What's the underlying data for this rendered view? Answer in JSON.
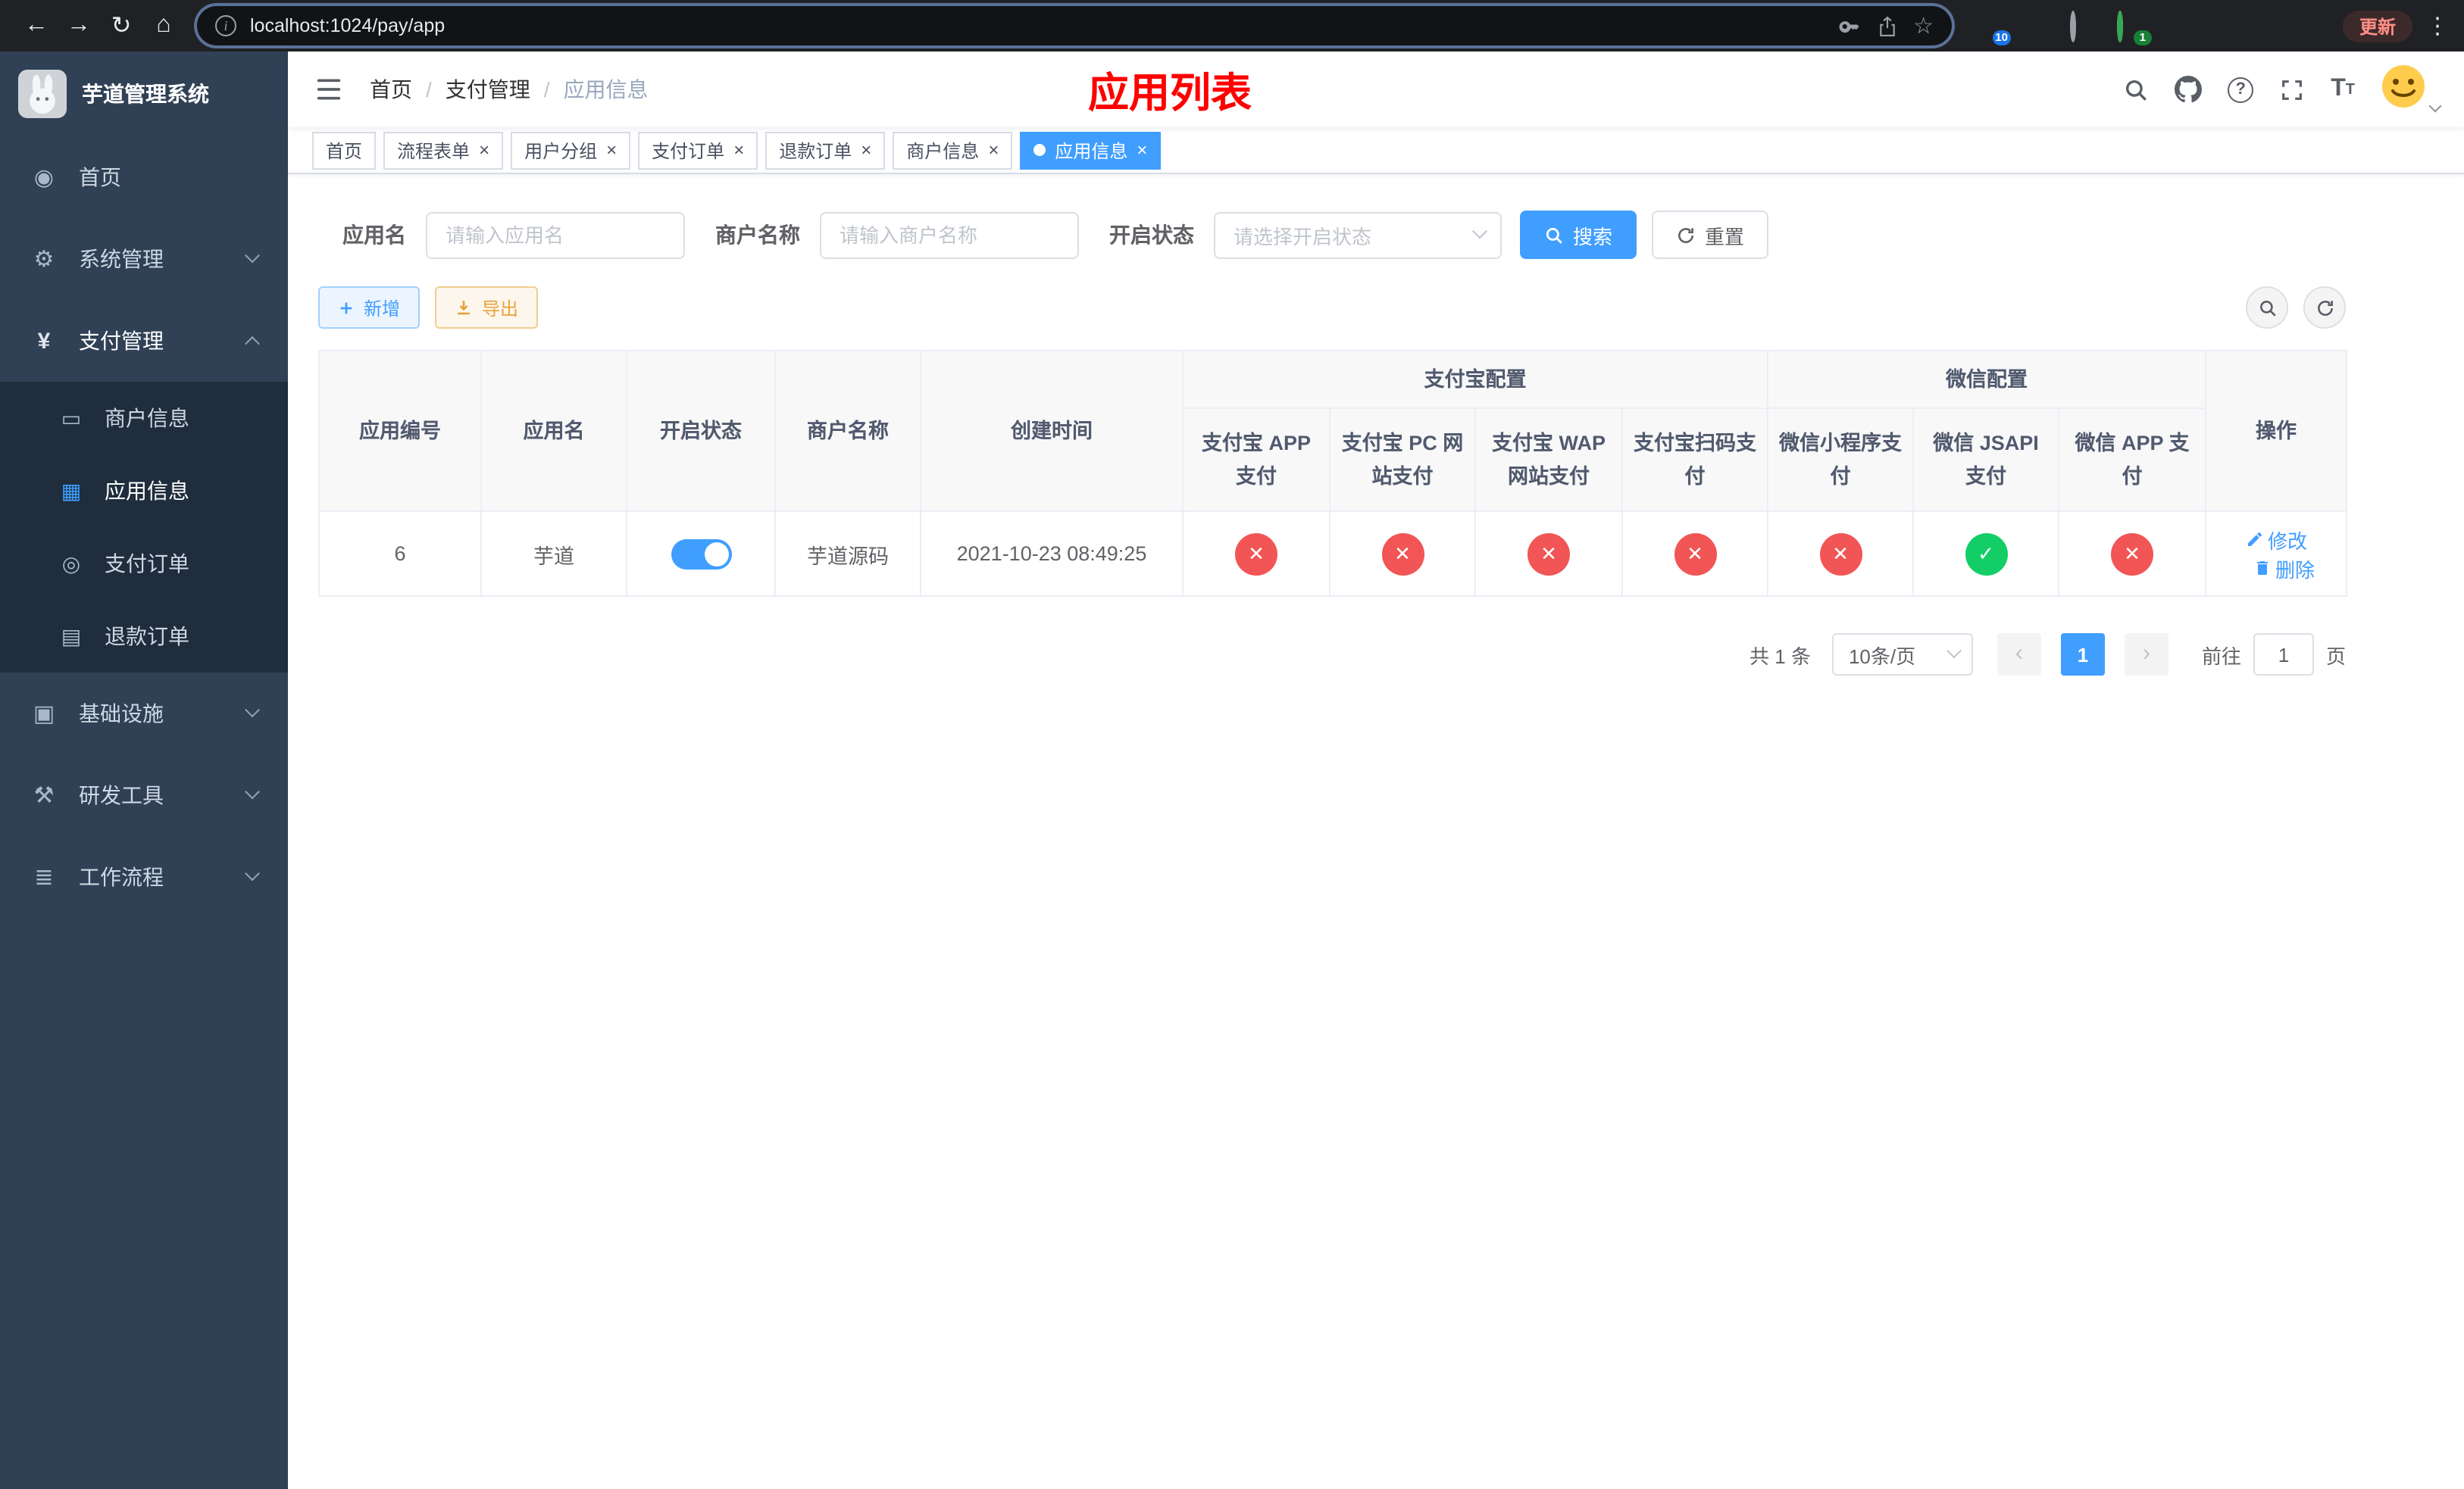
{
  "browser": {
    "url": "localhost:1024/pay/app",
    "update_label": "更新",
    "ext_badge_a": "10",
    "ext_badge_b": "1"
  },
  "sidebar": {
    "logo_title": "芋道管理系统",
    "home": "首页",
    "system": "系统管理",
    "payment": "支付管理",
    "merchant": "商户信息",
    "app_info": "应用信息",
    "pay_order": "支付订单",
    "refund_order": "退款订单",
    "infra": "基础设施",
    "devtools": "研发工具",
    "workflow": "工作流程"
  },
  "navbar": {
    "breadcrumb_home": "首页",
    "breadcrumb_payment": "支付管理",
    "breadcrumb_current": "应用信息",
    "title": "应用列表"
  },
  "tabs": {
    "home": "首页",
    "flow_form": "流程表单",
    "user_group": "用户分组",
    "pay_order": "支付订单",
    "refund_order": "退款订单",
    "merchant": "商户信息",
    "app_info": "应用信息"
  },
  "filters": {
    "app_name_label": "应用名",
    "app_name_placeholder": "请输入应用名",
    "merchant_label": "商户名称",
    "merchant_placeholder": "请输入商户名称",
    "status_label": "开启状态",
    "status_placeholder": "请选择开启状态",
    "search_label": "搜索",
    "reset_label": "重置"
  },
  "toolbar": {
    "add_label": "新增",
    "export_label": "导出"
  },
  "table": {
    "col_app_id": "应用编号",
    "col_app_name": "应用名",
    "col_status": "开启状态",
    "col_merchant": "商户名称",
    "col_create_time": "创建时间",
    "group_alipay": "支付宝配置",
    "group_wechat": "微信配置",
    "col_alipay_app": "支付宝 APP 支付",
    "col_alipay_pc": "支付宝 PC 网站支付",
    "col_alipay_wap": "支付宝 WAP 网站支付",
    "col_alipay_scan": "支付宝扫码支付",
    "col_wechat_mini": "微信小程序支付",
    "col_wechat_jsapi": "微信 JSAPI 支付",
    "col_wechat_app": "微信 APP 支付",
    "col_actions": "操作",
    "rows": [
      {
        "app_id": "6",
        "app_name": "芋道",
        "enabled": true,
        "merchant": "芋道源码",
        "create_time": "2021-10-23 08:49:25",
        "statuses": {
          "alipay_app": false,
          "alipay_pc": false,
          "alipay_wap": false,
          "alipay_scan": false,
          "wechat_mini": false,
          "wechat_jsapi": true,
          "wechat_app": false
        },
        "edit_label": "修改",
        "delete_label": "删除"
      }
    ]
  },
  "pagination": {
    "total": "共 1 条",
    "page_size": "10条/页",
    "page_1": "1",
    "goto": "前往",
    "goto_value": "1",
    "unit": "页"
  },
  "colors": {
    "primary": "#409eff",
    "danger": "#f25555",
    "success": "#13ce66",
    "warning": "#e6a23c",
    "title_red": "#ff0000",
    "sidebar_bg": "#304156",
    "submenu_bg": "#1f2d3d"
  }
}
